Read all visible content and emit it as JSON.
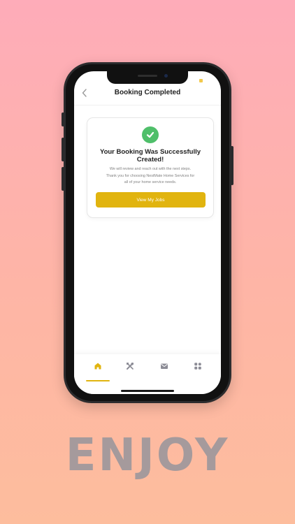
{
  "header": {
    "title": "Booking Completed",
    "back_icon": "chevron-left-icon"
  },
  "card": {
    "icon": "check-circle-icon",
    "title": "Your Booking Was Successfully Created!",
    "message_line1": "We will review and reach out with the next steps.",
    "message_line2": "Thank you for choosing NestMate Home Services for",
    "message_line3": "all of your home service needs.",
    "button_label": "View My Jobs"
  },
  "bottom_nav": {
    "items": [
      {
        "icon": "home-icon",
        "active": true
      },
      {
        "icon": "tools-icon",
        "active": false
      },
      {
        "icon": "mail-icon",
        "active": false
      },
      {
        "icon": "apps-icon",
        "active": false
      }
    ]
  },
  "promo": {
    "text": "ENJOY"
  },
  "colors": {
    "accent": "#e1b40f",
    "success": "#4fbf6a",
    "background_top": "#feacb9",
    "background_bottom": "#fdbd9d",
    "promo_text": "#a59a9c"
  }
}
